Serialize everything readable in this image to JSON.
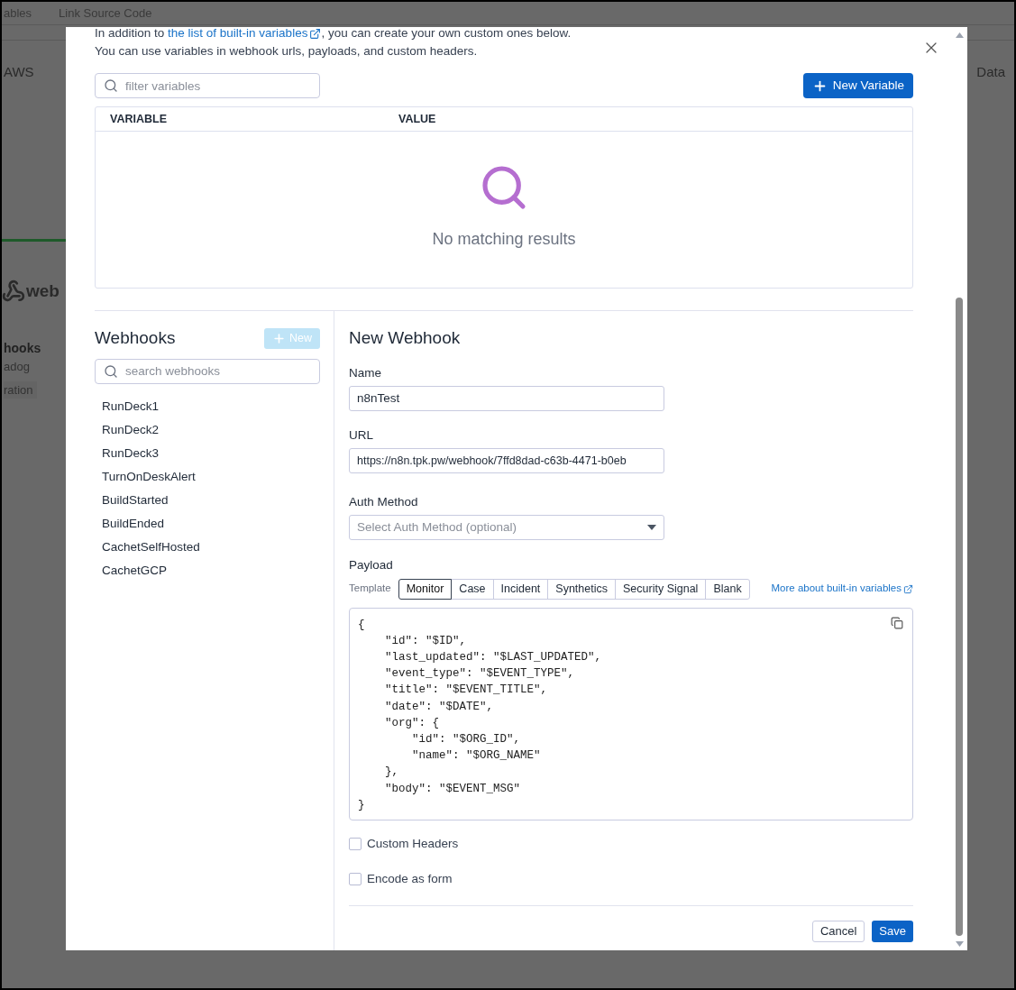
{
  "background": {
    "tabs": [
      "ables",
      "Link Source Code"
    ],
    "filters": [
      "AWS",
      "Data"
    ],
    "card": {
      "logo_text": "web",
      "title": "hooks",
      "subtitle": "adog",
      "tag": "ration"
    }
  },
  "variables": {
    "intro_before": "In addition to ",
    "intro_link": "the list of built-in variables",
    "intro_after": ", you can create your own custom ones below.",
    "intro_2": "You can use variables in webhook urls, payloads, and custom headers.",
    "filter_placeholder": "filter variables",
    "new_button": "New Variable",
    "columns": [
      "VARIABLE",
      "VALUE"
    ],
    "empty_message": "No matching results"
  },
  "webhooks": {
    "title": "Webhooks",
    "new_button": {
      "label": "New",
      "disabled": true
    },
    "search_placeholder": "search webhooks",
    "items": [
      "RunDeck1",
      "RunDeck2",
      "RunDeck3",
      "TurnOnDeskAlert",
      "BuildStarted",
      "BuildEnded",
      "CachetSelfHosted",
      "CachetGCP"
    ]
  },
  "form": {
    "title": "New Webhook",
    "name": {
      "label": "Name",
      "value": "n8nTest"
    },
    "url": {
      "label": "URL",
      "value": "https://n8n.tpk.pw/webhook/7ffd8dad-c63b-4471-b0eb"
    },
    "auth": {
      "label": "Auth Method",
      "placeholder": "Select Auth Method (optional)"
    },
    "payload_label": "Payload",
    "template_label": "Template",
    "templates": [
      {
        "label": "Monitor",
        "selected": true
      },
      {
        "label": "Case",
        "selected": false
      },
      {
        "label": "Incident",
        "selected": false
      },
      {
        "label": "Synthetics",
        "selected": false
      },
      {
        "label": "Security Signal",
        "selected": false
      },
      {
        "label": "Blank",
        "selected": false
      }
    ],
    "more_link": "More about built-in variables",
    "code": "{\n    \"id\": \"$ID\",\n    \"last_updated\": \"$LAST_UPDATED\",\n    \"event_type\": \"$EVENT_TYPE\",\n    \"title\": \"$EVENT_TITLE\",\n    \"date\": \"$DATE\",\n    \"org\": {\n        \"id\": \"$ORG_ID\",\n        \"name\": \"$ORG_NAME\"\n    },\n    \"body\": \"$EVENT_MSG\"\n}",
    "options": [
      {
        "label": "Custom Headers",
        "checked": false
      },
      {
        "label": "Encode as form",
        "checked": false
      }
    ],
    "buttons": {
      "cancel": "Cancel",
      "save": "Save"
    }
  }
}
